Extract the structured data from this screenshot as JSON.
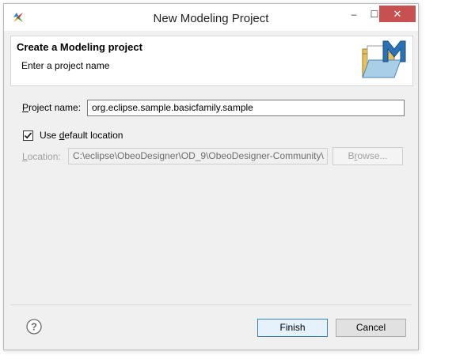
{
  "window": {
    "title": "New Modeling Project",
    "minimize_glyph": "–",
    "maximize_glyph": "☐",
    "close_glyph": "✕"
  },
  "banner": {
    "title": "Create a Modeling project",
    "message": "Enter a project name",
    "image": "modeling-project-wizard-icon"
  },
  "form": {
    "project_name_label_prefix": "P",
    "project_name_label_rest": "roject name:",
    "project_name_value": "org.eclipse.sample.basicfamily.sample",
    "use_default_checked": true,
    "use_default_label_prefix": "Use ",
    "use_default_label_mnemonic": "d",
    "use_default_label_rest": "efault location",
    "location_label_mnemonic": "L",
    "location_label_rest": "ocation:",
    "location_value": "C:\\eclipse\\ObeoDesigner\\OD_9\\ObeoDesigner-Community\\",
    "browse_label_mnemonic": "r",
    "browse_label_prefix": "B",
    "browse_label_rest": "owse..."
  },
  "footer": {
    "help_icon": "help-icon",
    "finish_label": "Finish",
    "cancel_label": "Cancel"
  },
  "colors": {
    "close_button": "#c75050",
    "default_button_border": "#3c7fb1"
  }
}
